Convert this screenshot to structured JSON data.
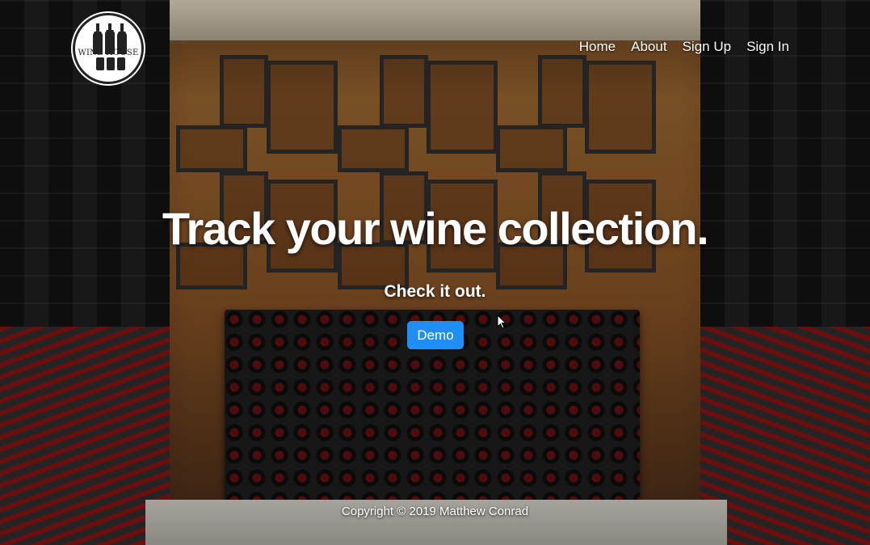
{
  "brand": {
    "logo_text": "WINE HOUSE"
  },
  "nav": {
    "items": [
      {
        "label": "Home"
      },
      {
        "label": "About"
      },
      {
        "label": "Sign Up"
      },
      {
        "label": "Sign In"
      }
    ]
  },
  "hero": {
    "title": "Track your wine collection.",
    "subtitle": "Check it out.",
    "button_label": "Demo"
  },
  "footer": {
    "copyright": "Copyright © 2019 Matthew Conrad"
  },
  "colors": {
    "button": "#1f8ef7",
    "text": "#ffffff"
  },
  "icons": [
    "wine-house-logo",
    "mouse-cursor-icon"
  ]
}
